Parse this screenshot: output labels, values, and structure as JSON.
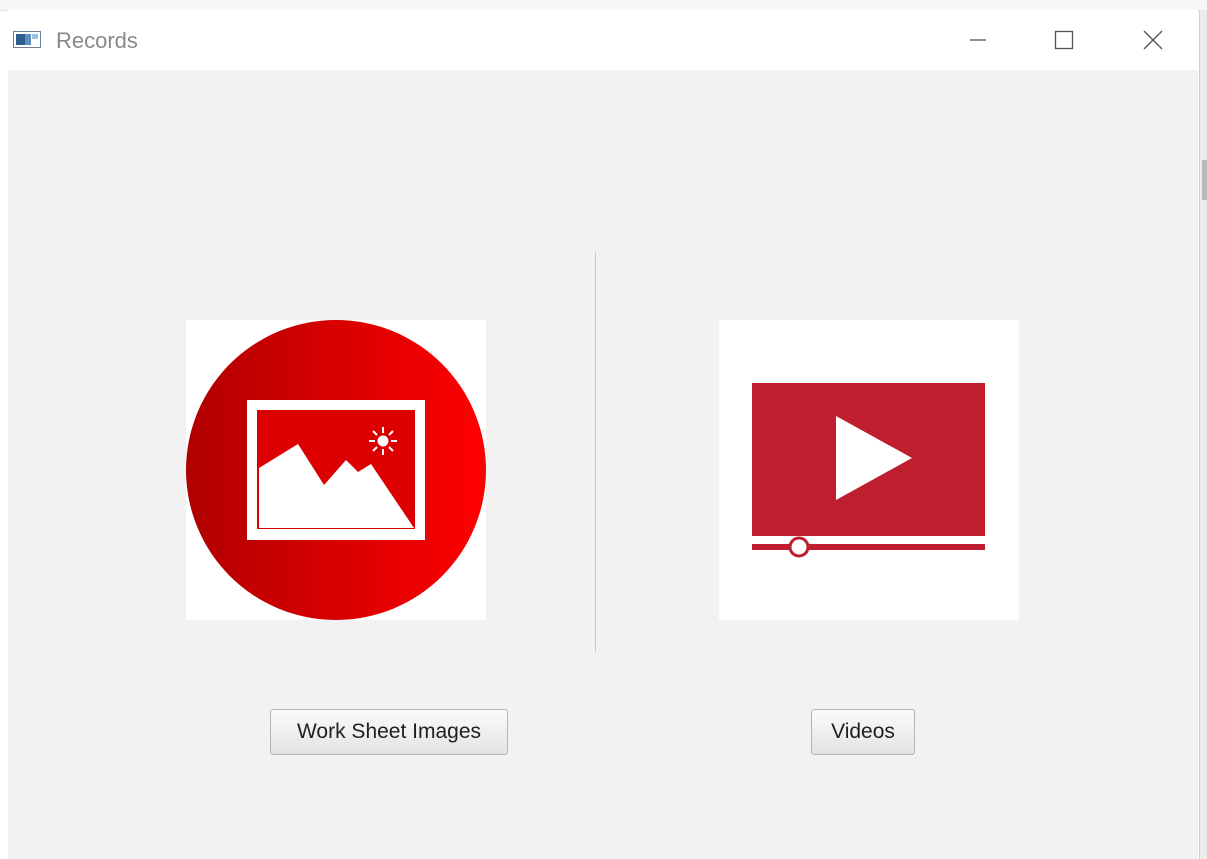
{
  "window": {
    "title": "Records",
    "controls": {
      "minimize": "minimize-icon",
      "maximize": "maximize-icon",
      "close": "close-icon"
    }
  },
  "panels": [
    {
      "icon": "picture-icon",
      "icon_color": "#e00000",
      "button_label": "Work Sheet Images"
    },
    {
      "icon": "video-player-icon",
      "icon_color": "#be1e2d",
      "button_label": "Videos"
    }
  ]
}
